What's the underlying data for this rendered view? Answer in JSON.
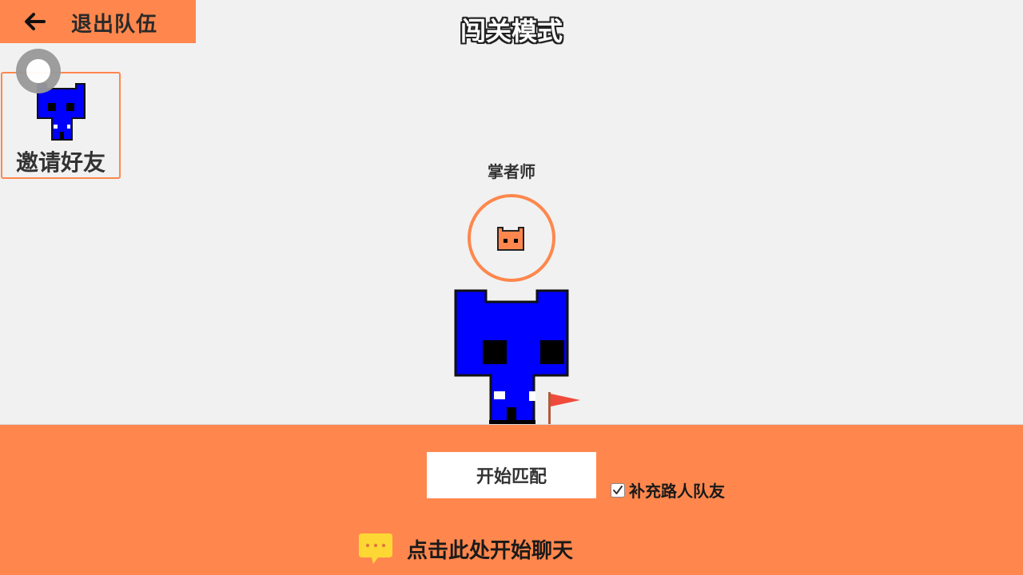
{
  "header": {
    "exit_label": "退出队伍",
    "title": "闯关模式"
  },
  "invite": {
    "label": "邀请好友"
  },
  "player": {
    "name": "掌者师",
    "avatar_color": "#ff874d",
    "character_color": "#0000ff"
  },
  "bottom": {
    "match_label": "开始匹配",
    "fill_teammates_label": "补充路人队友",
    "fill_teammates_checked": true,
    "chat_label": "点击此处开始聊天"
  },
  "colors": {
    "accent": "#ff874d",
    "background": "#f1f1f1",
    "chat_icon": "#fdd835",
    "flag": "#f04a3a"
  },
  "icons": [
    "back-arrow-icon",
    "loading-ring-icon",
    "cat-avatar-icon",
    "flag-icon",
    "check-icon",
    "chat-bubble-icon"
  ]
}
